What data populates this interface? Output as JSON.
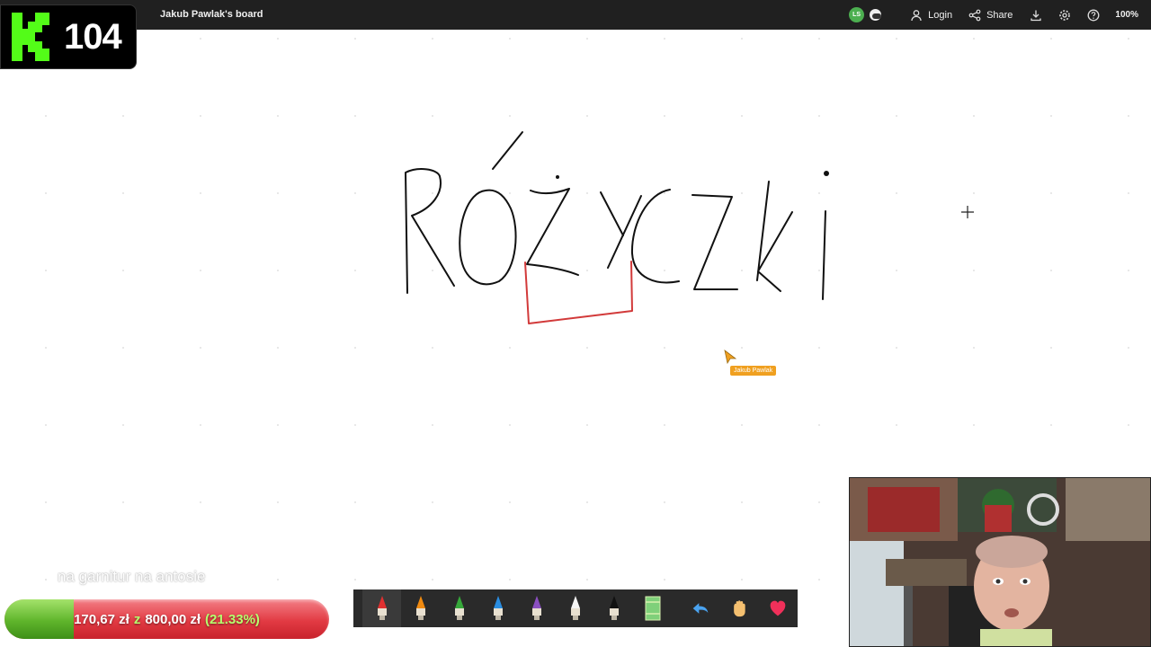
{
  "topbar": {
    "board_title": "Jakub Pawlak's board",
    "avatar_initials": "LS",
    "login_label": "Login",
    "share_label": "Share",
    "zoom": "100%",
    "icons": [
      "user-icon",
      "share-icon",
      "download-icon",
      "gear-icon",
      "help-icon"
    ]
  },
  "logo": {
    "number": "104",
    "mark": "K"
  },
  "board": {
    "drawn_text": "Różyczki",
    "cursor_user": "Jakub Pawlak",
    "colors": {
      "ink": "#111111",
      "red_stroke": "#d23a3a",
      "cursor": "#f0a020"
    }
  },
  "overlay": {
    "caption": "na garnitur na antosie",
    "donation": {
      "current": "170,67 zł",
      "separator": "z",
      "goal": "800,00 zł",
      "percent_label": "(21.33%)",
      "fraction": 0.2133
    }
  },
  "toolbar": {
    "tools": [
      {
        "name": "red-marker",
        "color": "#e03030"
      },
      {
        "name": "orange-marker",
        "color": "#f08a10"
      },
      {
        "name": "green-marker",
        "color": "#36a83a"
      },
      {
        "name": "blue-marker",
        "color": "#2a8de0"
      },
      {
        "name": "purple-marker",
        "color": "#8a4fc0"
      },
      {
        "name": "white-marker",
        "color": "#f5f5f5"
      },
      {
        "name": "black-marker",
        "color": "#111111"
      },
      {
        "name": "eraser",
        "color": "#7fd07a"
      },
      {
        "name": "undo",
        "color": "#4aa3f0"
      },
      {
        "name": "hand",
        "color": "#f5c070"
      },
      {
        "name": "heart",
        "color": "#f0305a"
      }
    ]
  }
}
